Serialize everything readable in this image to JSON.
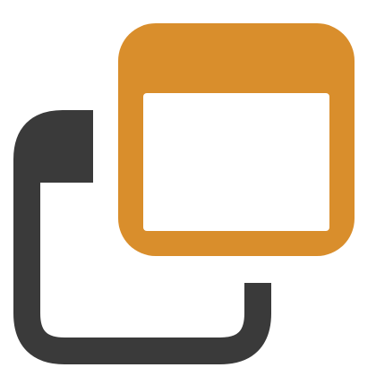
{
  "icon": {
    "name": "new-window-icon",
    "colors": {
      "window_frame": "#D98E2C",
      "window_fill": "#FFFFFF",
      "back_frame": "#3A3A3A",
      "background": "#FFFFFF"
    }
  }
}
